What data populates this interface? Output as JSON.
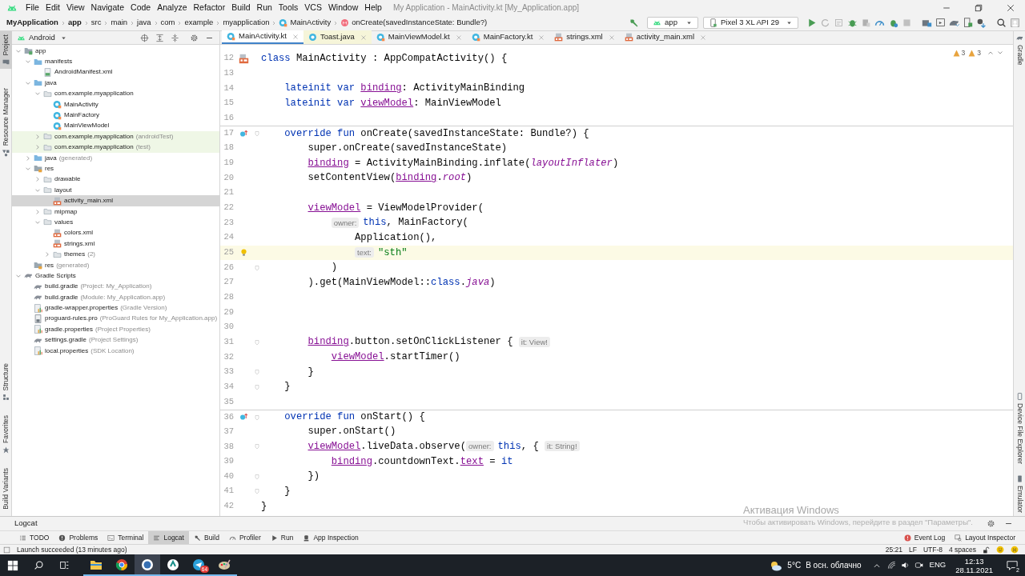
{
  "window": {
    "title": "My Application - MainActivity.kt [My_Application.app]",
    "menu": [
      "File",
      "Edit",
      "View",
      "Navigate",
      "Code",
      "Analyze",
      "Refactor",
      "Build",
      "Run",
      "Tools",
      "VCS",
      "Window",
      "Help"
    ]
  },
  "breadcrumbs": [
    {
      "label": "MyApplication",
      "bold": true,
      "kind": "plain"
    },
    {
      "label": "app",
      "bold": true,
      "kind": "plain"
    },
    {
      "label": "src",
      "bold": false,
      "kind": "plain"
    },
    {
      "label": "main",
      "bold": false,
      "kind": "plain"
    },
    {
      "label": "java",
      "bold": false,
      "kind": "plain"
    },
    {
      "label": "com",
      "bold": false,
      "kind": "plain"
    },
    {
      "label": "example",
      "bold": false,
      "kind": "plain"
    },
    {
      "label": "myapplication",
      "bold": false,
      "kind": "plain"
    },
    {
      "label": "MainActivity",
      "bold": false,
      "kind": "class"
    },
    {
      "label": "onCreate(savedInstanceState: Bundle?)",
      "bold": false,
      "kind": "method"
    }
  ],
  "toolbar": {
    "configuration": "app",
    "device": "Pixel 3 XL API 29"
  },
  "left_strip": [
    {
      "label": "Project",
      "selected": true
    },
    {
      "label": "Resource Manager",
      "selected": false
    },
    {
      "label": "Structure",
      "selected": false
    },
    {
      "label": "Favorites",
      "selected": false
    },
    {
      "label": "Build Variants",
      "selected": false
    }
  ],
  "right_strip": [
    {
      "label": "Gradle"
    },
    {
      "label": "Device File Explorer"
    },
    {
      "label": "Emulator"
    }
  ],
  "project_panel": {
    "view": "Android",
    "tree": [
      {
        "label": "app",
        "kind": "module",
        "expanded": true,
        "selected": false,
        "highlighted": false,
        "children": [
          {
            "label": "manifests",
            "kind": "folder",
            "expanded": true,
            "selected": false,
            "highlighted": false,
            "children": [
              {
                "label": "AndroidManifest.xml",
                "kind": "manifest",
                "selected": false,
                "highlighted": false
              }
            ]
          },
          {
            "label": "java",
            "kind": "folder",
            "expanded": true,
            "selected": false,
            "highlighted": false,
            "children": [
              {
                "label": "com.example.myapplication",
                "kind": "package",
                "expanded": true,
                "selected": false,
                "highlighted": false,
                "children": [
                  {
                    "label": "MainActivity",
                    "kind": "kclass",
                    "selected": false,
                    "highlighted": false
                  },
                  {
                    "label": "MainFactory",
                    "kind": "kclass",
                    "selected": false,
                    "highlighted": false
                  },
                  {
                    "label": "MainViewModel",
                    "kind": "kclass",
                    "selected": false,
                    "highlighted": false
                  }
                ]
              },
              {
                "label": "com.example.myapplication",
                "suffix": "(androidTest)",
                "kind": "package",
                "expanded": false,
                "selected": false,
                "highlighted": true
              },
              {
                "label": "com.example.myapplication",
                "suffix": "(test)",
                "kind": "package",
                "expanded": false,
                "selected": false,
                "highlighted": true
              }
            ]
          },
          {
            "label": "java",
            "suffix": "(generated)",
            "kind": "folder",
            "expanded": false,
            "selected": false,
            "highlighted": false
          },
          {
            "label": "res",
            "kind": "resfolder",
            "expanded": true,
            "selected": false,
            "highlighted": false,
            "children": [
              {
                "label": "drawable",
                "kind": "package",
                "expanded": false,
                "selected": false,
                "highlighted": false
              },
              {
                "label": "layout",
                "kind": "package",
                "expanded": true,
                "selected": false,
                "highlighted": false,
                "children": [
                  {
                    "label": "activity_main.xml",
                    "kind": "xml",
                    "selected": true,
                    "highlighted": false
                  }
                ]
              },
              {
                "label": "mipmap",
                "kind": "package",
                "expanded": false,
                "selected": false,
                "highlighted": false
              },
              {
                "label": "values",
                "kind": "package",
                "expanded": true,
                "selected": false,
                "highlighted": false,
                "children": [
                  {
                    "label": "colors.xml",
                    "kind": "xml",
                    "selected": false,
                    "highlighted": false
                  },
                  {
                    "label": "strings.xml",
                    "kind": "xml",
                    "selected": false,
                    "highlighted": false
                  },
                  {
                    "label": "themes",
                    "suffix": "(2)",
                    "kind": "package",
                    "expanded": false,
                    "selected": false,
                    "highlighted": false
                  }
                ]
              }
            ]
          },
          {
            "label": "res",
            "suffix": "(generated)",
            "kind": "resfolder",
            "selected": false,
            "highlighted": false
          }
        ]
      },
      {
        "label": "Gradle Scripts",
        "kind": "gradle",
        "expanded": true,
        "selected": false,
        "highlighted": false,
        "children": [
          {
            "label": "build.gradle",
            "suffix": "(Project: My_Application)",
            "kind": "gradle",
            "selected": false,
            "highlighted": false
          },
          {
            "label": "build.gradle",
            "suffix": "(Module: My_Application.app)",
            "kind": "gradle",
            "selected": false,
            "highlighted": false
          },
          {
            "label": "gradle-wrapper.properties",
            "suffix": "(Gradle Version)",
            "kind": "properties",
            "selected": false,
            "highlighted": false
          },
          {
            "label": "proguard-rules.pro",
            "suffix": "(ProGuard Rules for My_Application.app)",
            "kind": "pro",
            "selected": false,
            "highlighted": false
          },
          {
            "label": "gradle.properties",
            "suffix": "(Project Properties)",
            "kind": "properties",
            "selected": false,
            "highlighted": false
          },
          {
            "label": "settings.gradle",
            "suffix": "(Project Settings)",
            "kind": "gradle",
            "selected": false,
            "highlighted": false
          },
          {
            "label": "local.properties",
            "suffix": "(SDK Location)",
            "kind": "properties",
            "selected": false,
            "highlighted": false
          }
        ]
      }
    ]
  },
  "tabs": [
    {
      "label": "MainActivity.kt",
      "kind": "kclass",
      "selected": true,
      "modified": false
    },
    {
      "label": "Toast.java",
      "kind": "jclass",
      "selected": false,
      "modified": true
    },
    {
      "label": "MainViewModel.kt",
      "kind": "kclass",
      "selected": false,
      "modified": false
    },
    {
      "label": "MainFactory.kt",
      "kind": "kclass",
      "selected": false,
      "modified": false
    },
    {
      "label": "strings.xml",
      "kind": "xml",
      "selected": false,
      "modified": false
    },
    {
      "label": "activity_main.xml",
      "kind": "xml",
      "selected": false,
      "modified": false
    }
  ],
  "inspections": [
    "3",
    "3"
  ],
  "code": [
    {
      "number": "12",
      "kind": "activity",
      "fold": false,
      "separator": false,
      "current": false,
      "segments": [
        {
          "kind": "keyword",
          "text": "class"
        },
        {
          "kind": "plain",
          "text": " MainActivity : AppCompatActivity() {"
        }
      ]
    },
    {
      "number": "13",
      "kind": "plain",
      "fold": false,
      "separator": false,
      "current": false
    },
    {
      "number": "14",
      "kind": "plain",
      "fold": false,
      "separator": false,
      "current": false,
      "segments": [
        {
          "kind": "keyword",
          "text": "    lateinit var "
        },
        {
          "kind": "property",
          "text": "binding"
        },
        {
          "kind": "plain",
          "text": ": ActivityMainBinding"
        }
      ]
    },
    {
      "number": "15",
      "kind": "plain",
      "fold": false,
      "separator": false,
      "current": false,
      "segments": [
        {
          "kind": "keyword",
          "text": "    lateinit var "
        },
        {
          "kind": "property",
          "text": "viewModel"
        },
        {
          "kind": "plain",
          "text": ": MainViewModel"
        }
      ]
    },
    {
      "number": "16",
      "kind": "plain",
      "fold": false,
      "separator": false,
      "current": false
    },
    {
      "number": "17",
      "kind": "override",
      "fold": true,
      "separator": true,
      "current": false,
      "segments": [
        {
          "kind": "keyword",
          "text": "    override fun "
        },
        {
          "kind": "plain",
          "text": "onCreate(savedInstanceState: Bundle?) {"
        }
      ]
    },
    {
      "number": "18",
      "kind": "plain",
      "fold": false,
      "separator": false,
      "current": false,
      "segments": [
        {
          "kind": "plain",
          "text": "        super.onCreate(savedInstanceState)"
        }
      ]
    },
    {
      "number": "19",
      "kind": "plain",
      "fold": false,
      "separator": false,
      "current": false,
      "segments": [
        {
          "kind": "property",
          "text": "        binding"
        },
        {
          "kind": "plain",
          "text": " = ActivityMainBinding.inflate("
        },
        {
          "kind": "italic",
          "text": "layoutInflater"
        },
        {
          "kind": "plain",
          "text": ")"
        }
      ]
    },
    {
      "number": "20",
      "kind": "plain",
      "fold": false,
      "separator": false,
      "current": false,
      "segments": [
        {
          "kind": "plain",
          "text": "        setContentView("
        },
        {
          "kind": "property",
          "text": "binding"
        },
        {
          "kind": "plain",
          "text": "."
        },
        {
          "kind": "italic",
          "text": "root"
        },
        {
          "kind": "plain",
          "text": ")"
        }
      ]
    },
    {
      "number": "21",
      "kind": "plain",
      "fold": false,
      "separator": false,
      "current": false
    },
    {
      "number": "22",
      "kind": "plain",
      "fold": false,
      "separator": false,
      "current": false,
      "segments": [
        {
          "kind": "property",
          "text": "        viewModel"
        },
        {
          "kind": "plain",
          "text": " = ViewModelProvider("
        }
      ]
    },
    {
      "number": "23",
      "kind": "plain",
      "fold": false,
      "separator": false,
      "current": false,
      "segments": [
        {
          "kind": "hint",
          "text": "            owner:"
        },
        {
          "kind": "keyword",
          "text": "this"
        },
        {
          "kind": "plain",
          "text": ", MainFactory("
        }
      ]
    },
    {
      "number": "24",
      "kind": "plain",
      "fold": false,
      "separator": false,
      "current": false,
      "segments": [
        {
          "kind": "plain",
          "text": "                Application(),"
        }
      ]
    },
    {
      "number": "25",
      "kind": "bulb",
      "fold": false,
      "separator": false,
      "current": true,
      "segments": [
        {
          "kind": "hint",
          "text": "                text:"
        },
        {
          "kind": "string",
          "text": "\"sth\""
        }
      ]
    },
    {
      "number": "26",
      "kind": "plain",
      "fold": true,
      "separator": false,
      "current": false,
      "segments": [
        {
          "kind": "plain",
          "text": "            )"
        }
      ]
    },
    {
      "number": "27",
      "kind": "plain",
      "fold": false,
      "separator": false,
      "current": false,
      "segments": [
        {
          "kind": "plain",
          "text": "        ).get(MainViewModel::"
        },
        {
          "kind": "keyword",
          "text": "class"
        },
        {
          "kind": "plain",
          "text": "."
        },
        {
          "kind": "italic",
          "text": "java"
        },
        {
          "kind": "plain",
          "text": ")"
        }
      ]
    },
    {
      "number": "28",
      "kind": "plain",
      "fold": false,
      "separator": false,
      "current": false
    },
    {
      "number": "29",
      "kind": "plain",
      "fold": false,
      "separator": false,
      "current": false
    },
    {
      "number": "30",
      "kind": "plain",
      "fold": false,
      "separator": false,
      "current": false
    },
    {
      "number": "31",
      "kind": "plain",
      "fold": true,
      "separator": false,
      "current": false,
      "segments": [
        {
          "kind": "property",
          "text": "        binding"
        },
        {
          "kind": "plain",
          "text": ".button.setOnClickListener { "
        },
        {
          "kind": "hint",
          "text": "it: View!"
        }
      ]
    },
    {
      "number": "32",
      "kind": "plain",
      "fold": false,
      "separator": false,
      "current": false,
      "segments": [
        {
          "kind": "property",
          "text": "            viewModel"
        },
        {
          "kind": "plain",
          "text": ".startTimer()"
        }
      ]
    },
    {
      "number": "33",
      "kind": "plain",
      "fold": true,
      "separator": false,
      "current": false,
      "segments": [
        {
          "kind": "plain",
          "text": "        }"
        }
      ]
    },
    {
      "number": "34",
      "kind": "plain",
      "fold": true,
      "separator": false,
      "current": false,
      "segments": [
        {
          "kind": "plain",
          "text": "    }"
        }
      ]
    },
    {
      "number": "35",
      "kind": "plain",
      "fold": false,
      "separator": false,
      "current": false
    },
    {
      "number": "36",
      "kind": "override",
      "fold": true,
      "separator": true,
      "current": false,
      "segments": [
        {
          "kind": "keyword",
          "text": "    override fun "
        },
        {
          "kind": "plain",
          "text": "onStart() {"
        }
      ]
    },
    {
      "number": "37",
      "kind": "plain",
      "fold": false,
      "separator": false,
      "current": false,
      "segments": [
        {
          "kind": "plain",
          "text": "        super.onStart()"
        }
      ]
    },
    {
      "number": "38",
      "kind": "plain",
      "fold": true,
      "separator": false,
      "current": false,
      "segments": [
        {
          "kind": "property",
          "text": "        viewModel"
        },
        {
          "kind": "plain",
          "text": ".liveData.observe("
        },
        {
          "kind": "hint",
          "text": "owner:"
        },
        {
          "kind": "keyword",
          "text": "this"
        },
        {
          "kind": "plain",
          "text": ", { "
        },
        {
          "kind": "hint",
          "text": "it: String!"
        }
      ]
    },
    {
      "number": "39",
      "kind": "plain",
      "fold": false,
      "separator": false,
      "current": false,
      "segments": [
        {
          "kind": "property",
          "text": "            binding"
        },
        {
          "kind": "plain",
          "text": ".countdownText."
        },
        {
          "kind": "property",
          "text": "text"
        },
        {
          "kind": "plain",
          "text": " = "
        },
        {
          "kind": "keyword",
          "text": "it"
        }
      ]
    },
    {
      "number": "40",
      "kind": "plain",
      "fold": true,
      "separator": false,
      "current": false,
      "segments": [
        {
          "kind": "plain",
          "text": "        })"
        }
      ]
    },
    {
      "number": "41",
      "kind": "plain",
      "fold": true,
      "separator": false,
      "current": false,
      "segments": [
        {
          "kind": "plain",
          "text": "    }"
        }
      ]
    },
    {
      "number": "42",
      "kind": "plain",
      "fold": false,
      "separator": false,
      "current": false,
      "segments": [
        {
          "kind": "plain",
          "text": "}"
        }
      ]
    }
  ],
  "logcat": {
    "title": "Logcat"
  },
  "tool_windows": [
    {
      "label": "TODO",
      "kind": "list",
      "selected": false
    },
    {
      "label": "Problems",
      "kind": "info",
      "selected": false
    },
    {
      "label": "Terminal",
      "kind": "terminal",
      "selected": false
    },
    {
      "label": "Logcat",
      "kind": "lines",
      "selected": true
    },
    {
      "label": "Build",
      "kind": "hammer",
      "selected": false
    },
    {
      "label": "Profiler",
      "kind": "gauge",
      "selected": false
    },
    {
      "label": "Run",
      "kind": "play",
      "selected": false
    },
    {
      "label": "App Inspection",
      "kind": "inspect",
      "selected": false
    }
  ],
  "tool_windows_right": [
    {
      "label": "Event Log",
      "kind": "alert",
      "selected": false
    },
    {
      "label": "Layout Inspector",
      "kind": "inspector",
      "selected": false
    }
  ],
  "status_bar": {
    "message": "Launch succeeded (13 minutes ago)",
    "items": [
      "25:21",
      "LF",
      "UTF-8",
      "4 spaces"
    ]
  },
  "windows_activation": {
    "title": "Активация Windows",
    "text": "Чтобы активировать Windows, перейдите в раздел \"Параметры\"."
  },
  "taskbar": {
    "apps": [
      {
        "kind": "folder",
        "active": false
      },
      {
        "kind": "browser",
        "active": false
      },
      {
        "kind": "ide",
        "active": true
      },
      {
        "kind": "chat",
        "active": false
      },
      {
        "kind": "messenger",
        "active": false,
        "badge": "64"
      },
      {
        "kind": "paint",
        "active": false
      }
    ],
    "weather": {
      "temperature": "5°C",
      "condition": "В осн. облачно"
    },
    "language": "ENG",
    "time": "12:13",
    "date": "28.11.2021",
    "notifications": "2"
  }
}
